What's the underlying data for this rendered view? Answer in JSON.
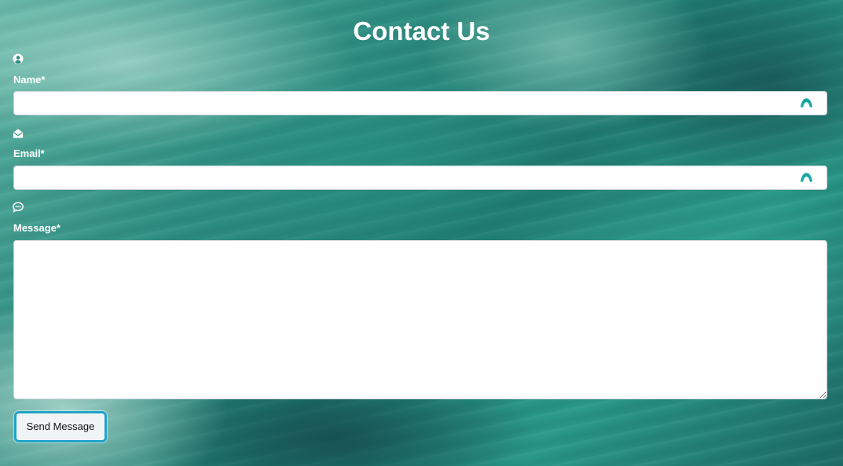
{
  "page": {
    "title": "Contact Us"
  },
  "form": {
    "name": {
      "icon": "user-circle-icon",
      "label": "Name*",
      "value": "",
      "placeholder": ""
    },
    "email": {
      "icon": "envelope-open-icon",
      "label": "Email*",
      "value": "",
      "placeholder": ""
    },
    "message": {
      "icon": "comment-dots-icon",
      "label": "Message*",
      "value": "",
      "placeholder": ""
    },
    "submit_label": "Send Message"
  },
  "icons": {
    "autofill": "autofill-extension-icon"
  },
  "colors": {
    "accent_teal": "#1aa7a3",
    "button_border": "#1fa3c9",
    "title_text": "#ffffff",
    "background_sea": "#2f8f82"
  }
}
